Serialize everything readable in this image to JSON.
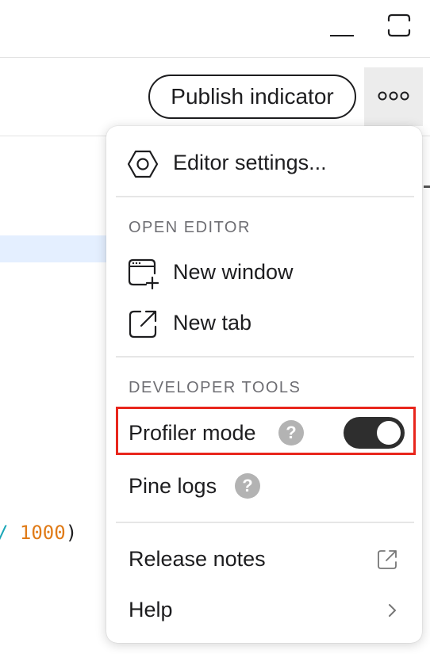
{
  "toolbar": {
    "publish_label": "Publish indicator"
  },
  "code": {
    "op": "/",
    "number": "1000",
    "paren": ")"
  },
  "menu": {
    "editor_settings_label": "Editor settings...",
    "open_editor_heading": "OPEN EDITOR",
    "new_window_label": "New window",
    "new_tab_label": "New tab",
    "developer_tools_heading": "DEVELOPER TOOLS",
    "profiler_mode_label": "Profiler mode",
    "profiler_mode_enabled": true,
    "pine_logs_label": "Pine logs",
    "help_mark": "?",
    "release_notes_label": "Release notes",
    "help_label": "Help"
  },
  "colors": {
    "highlight_border": "#e8261c",
    "toggle_on": "#2e2e2e",
    "code_number": "#e07b18",
    "code_operator": "#1aa6b7"
  }
}
